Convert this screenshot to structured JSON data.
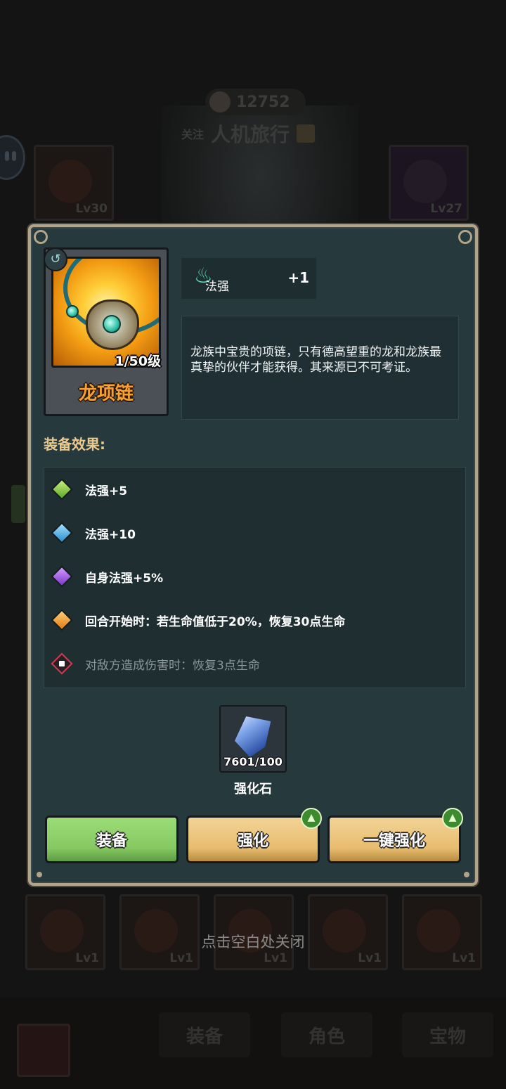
{
  "background": {
    "coins": "12752",
    "follow_label": "关注",
    "player_name": "人机旅行",
    "top_slots": [
      {
        "level": "Lv30"
      },
      {
        "level": "Lv27"
      }
    ],
    "bottom_slots": [
      {
        "level": "Lv1"
      },
      {
        "level": "Lv1"
      },
      {
        "level": "Lv1"
      },
      {
        "level": "Lv1"
      },
      {
        "level": "Lv1"
      }
    ],
    "tabs": [
      "装备",
      "角色",
      "宝物"
    ]
  },
  "item": {
    "name": "龙项链",
    "level": "1/50级",
    "stat_label": "法强",
    "stat_value": "+1",
    "description": "龙族中宝贵的项链，只有德高望重的龙和龙族最真挚的伙伴才能获得。其来源已不可考证。"
  },
  "effects_title": "装备效果:",
  "effects": [
    {
      "text": "法强+5",
      "color": "green"
    },
    {
      "text": "法强+10",
      "color": "blue"
    },
    {
      "text": "自身法强+5%",
      "color": "purple"
    },
    {
      "text": "回合开始时：若生命值低于20%，恢复30点生命",
      "color": "orange"
    },
    {
      "text": "对敌方造成伤害时：恢复3点生命",
      "color": "locked"
    }
  ],
  "material": {
    "count": "7601/100",
    "label": "强化石"
  },
  "buttons": {
    "equip": "装备",
    "upgrade": "强化",
    "auto_upgrade": "一键强化"
  },
  "close_hint": "点击空白处关闭",
  "colors": {
    "panel_bg": "#26393d",
    "panel_border": "#b2a488",
    "item_name": "#f7a131",
    "effects_title": "#e9c98d",
    "equip_button": "#86c862",
    "upgrade_button": "#e8bd6e"
  }
}
